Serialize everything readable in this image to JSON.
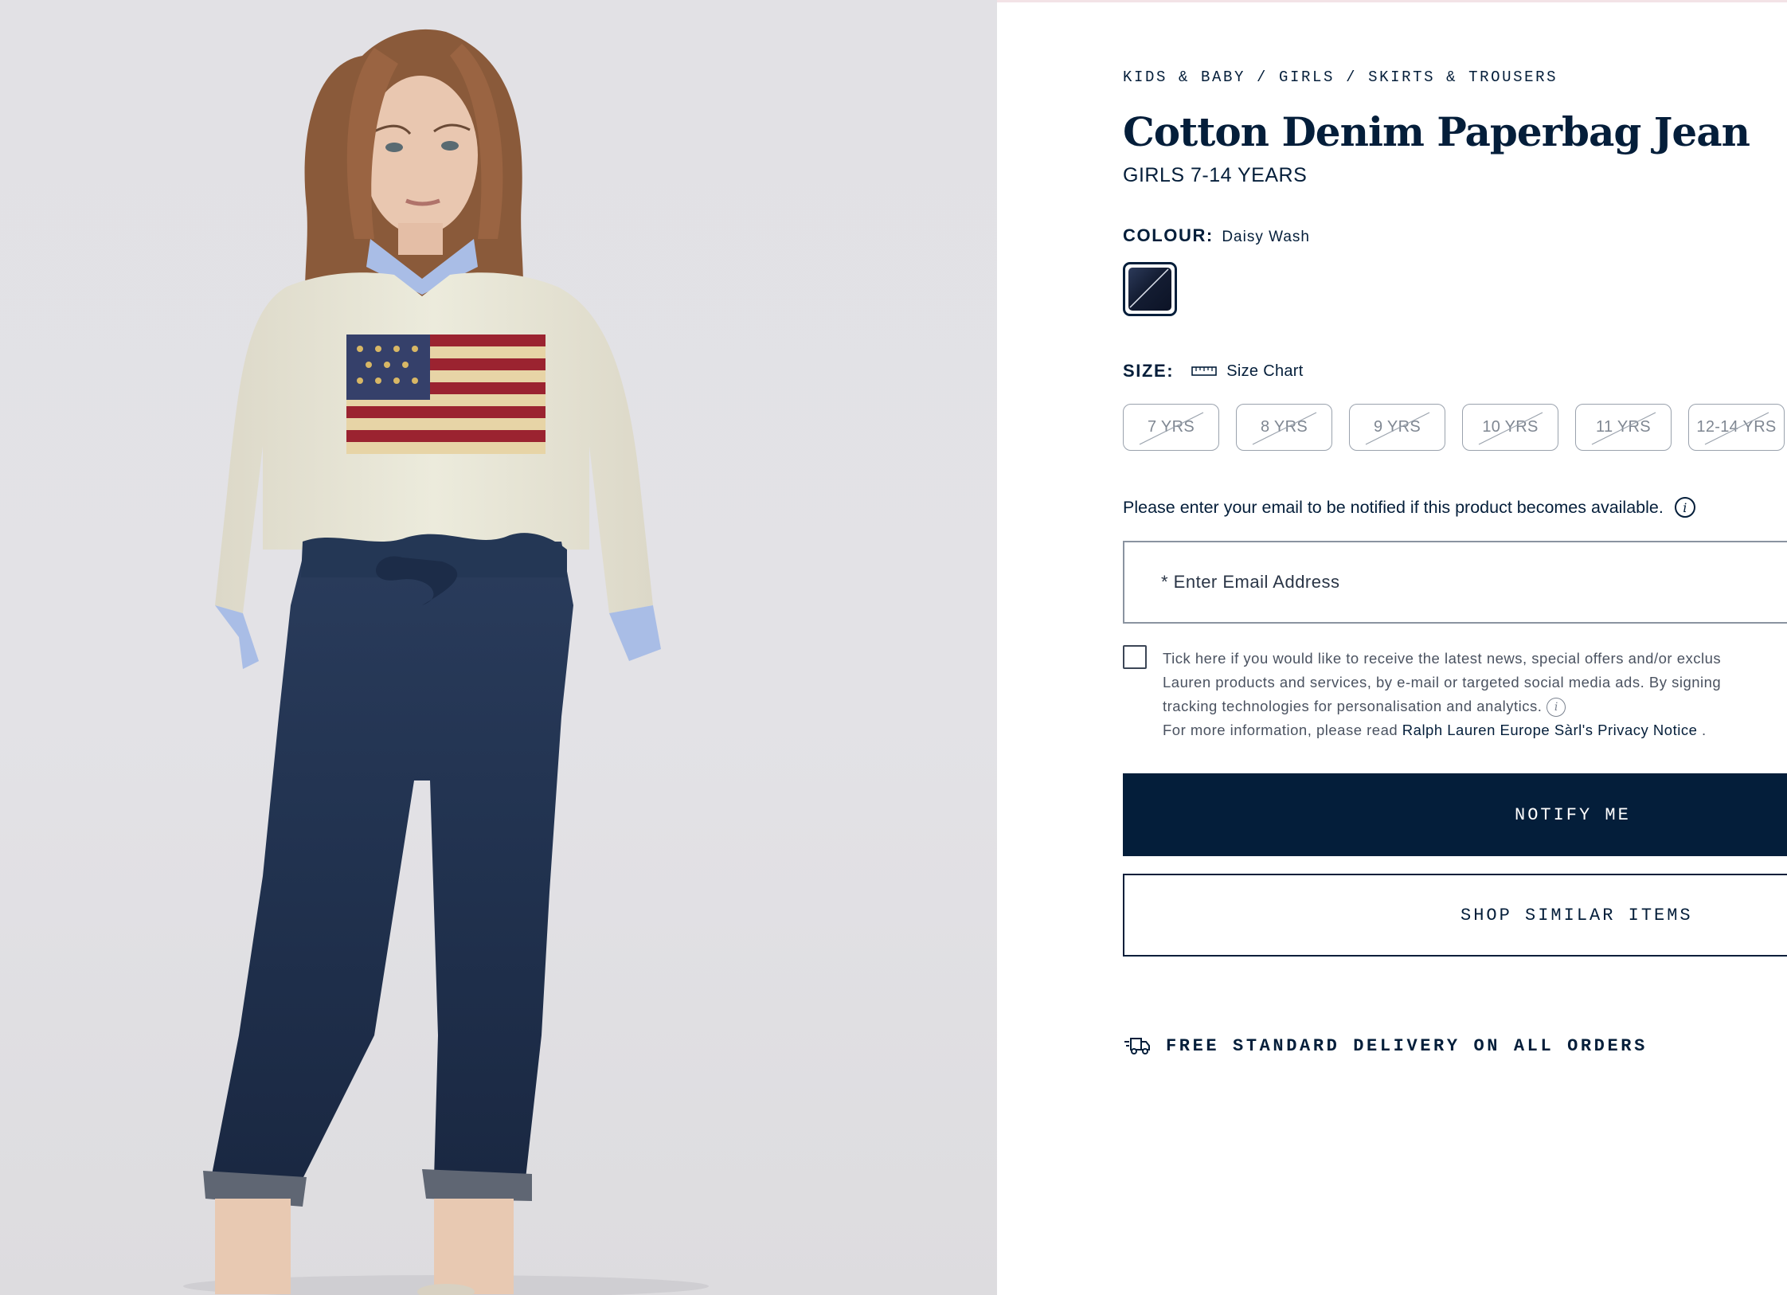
{
  "breadcrumb": [
    "KIDS & BABY",
    "GIRLS",
    "SKIRTS & TROUSERS"
  ],
  "product": {
    "title": "Cotton Denim Paperbag Jean",
    "subtitle": "GIRLS 7-14 YEARS"
  },
  "colour": {
    "label": "COLOUR:",
    "value": "Daisy Wash",
    "swatch_color": "#1a233c"
  },
  "size": {
    "label": "SIZE:",
    "chart_link": "Size Chart",
    "chart_icon": "ruler-icon",
    "options": [
      "7 YRS",
      "8 YRS",
      "9 YRS",
      "10 YRS",
      "11 YRS",
      "12-14 YRS"
    ],
    "availability": [
      "unavailable",
      "unavailable",
      "unavailable",
      "unavailable",
      "unavailable",
      "unavailable"
    ]
  },
  "notify": {
    "message": "Please enter your email to be notified if this product becomes available.",
    "info_icon": "info-icon",
    "email_placeholder": "* Enter Email Address"
  },
  "consent": {
    "line1": "Tick here if you would like to receive the latest news, special offers and/or exclus",
    "line2": "Lauren products and services, by e-mail or targeted social media ads. By signing",
    "line3": "tracking technologies for personalisation and analytics.",
    "line4_prefix": "For more information, please read",
    "privacy_link": "Ralph Lauren Europe Sàrl's Privacy Notice",
    "line4_suffix": "."
  },
  "buttons": {
    "notify_me": "NOTIFY ME",
    "shop_similar": "SHOP SIMILAR ITEMS"
  },
  "delivery": {
    "icon": "truck-icon",
    "text": "FREE STANDARD DELIVERY ON ALL ORDERS"
  },
  "colors": {
    "brand_navy": "#041e3a",
    "photo_background": "#e2e1e5"
  }
}
